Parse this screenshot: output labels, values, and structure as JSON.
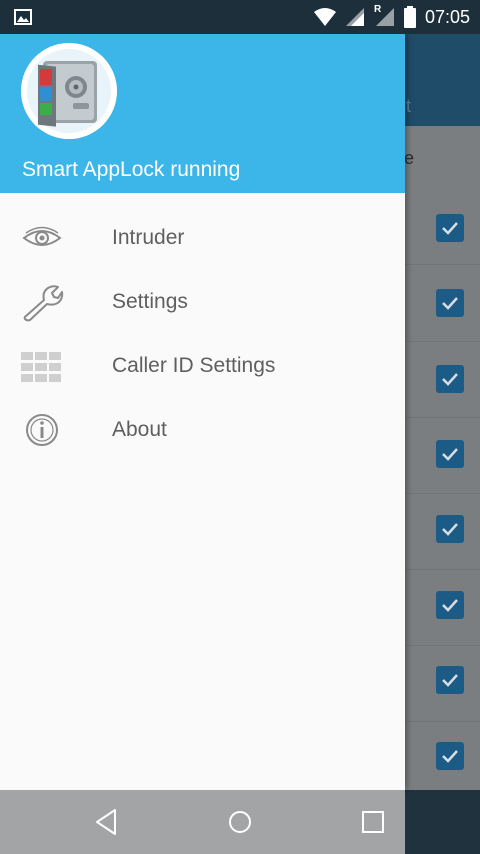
{
  "status_bar": {
    "time": "07:05",
    "roaming_label": "R",
    "icons": [
      "image-notification-icon",
      "wifi-icon",
      "cell-signal-icon",
      "roaming-signal-icon",
      "battery-icon"
    ]
  },
  "drawer": {
    "header_title": "Smart AppLock running",
    "header_color": "#3cb6e8",
    "items": [
      {
        "label": "Intruder",
        "icon": "eye-icon"
      },
      {
        "label": "Settings",
        "icon": "wrench-icon"
      },
      {
        "label": "Caller ID Settings",
        "icon": "grid-icon"
      },
      {
        "label": "About",
        "icon": "info-icon"
      }
    ]
  },
  "background_app": {
    "toolbar_fragment": "t",
    "header_fragment": "e",
    "checked_rows": 8
  },
  "nav_bar": {
    "buttons": [
      "back-icon",
      "home-icon",
      "recents-icon"
    ]
  }
}
